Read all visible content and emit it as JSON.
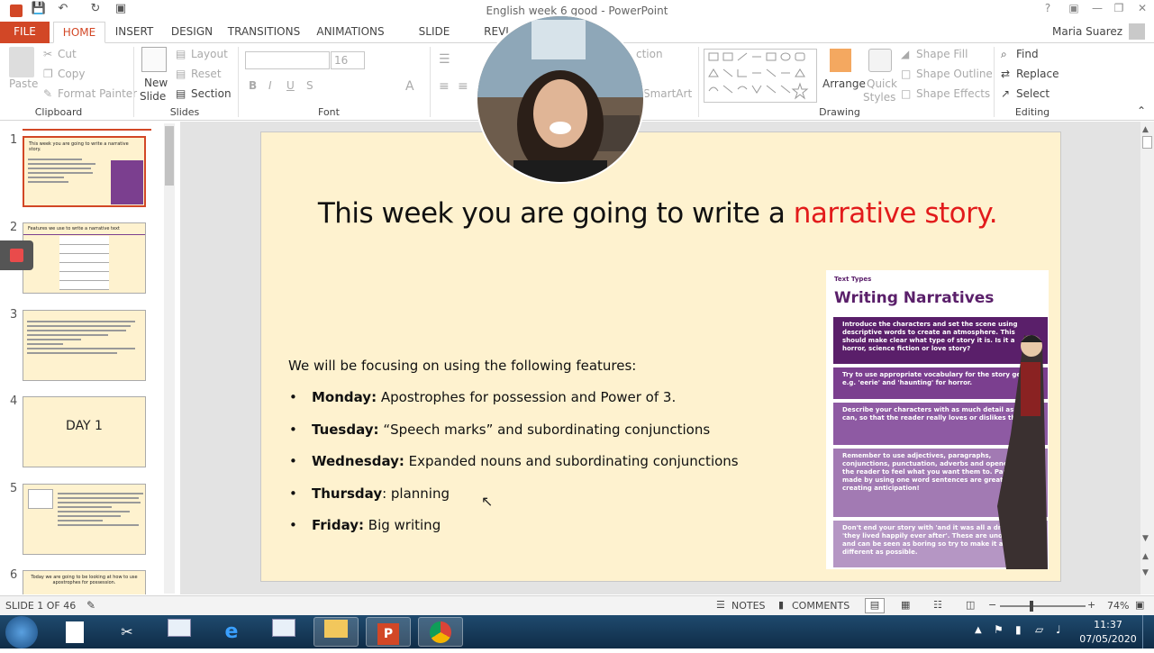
{
  "window": {
    "title": "English  week 6  good - PowerPoint",
    "user": "Maria Suarez"
  },
  "tabs": [
    {
      "label": "FILE"
    },
    {
      "label": "HOME"
    },
    {
      "label": "INSERT"
    },
    {
      "label": "DESIGN"
    },
    {
      "label": "TRANSITIONS"
    },
    {
      "label": "ANIMATIONS"
    },
    {
      "label": "SLIDE SHOW"
    },
    {
      "label": "REVI"
    }
  ],
  "ribbon": {
    "clipboard": {
      "paste": "Paste",
      "cut": "Cut",
      "copy": "Copy",
      "format_painter": "Format Painter",
      "group": "Clipboard"
    },
    "slides": {
      "new_slide_1": "New",
      "new_slide_2": "Slide",
      "layout": "Layout",
      "reset": "Reset",
      "section": "Section",
      "group": "Slides"
    },
    "font": {
      "size": "16",
      "group": "Font",
      "bold": "B",
      "italic": "I",
      "underline": "U",
      "shadow": "S"
    },
    "paragraph": {
      "direction": "ction",
      "smartart": "SmartArt"
    },
    "drawing": {
      "arrange_1": "Arrange",
      "quick_1": "Quick",
      "quick_2": "Styles",
      "shape_fill": "Shape Fill",
      "shape_outline": "Shape Outline",
      "shape_effects": "Shape Effects",
      "group": "Drawing"
    },
    "editing": {
      "find": "Find",
      "replace": "Replace",
      "select": "Select",
      "group": "Editing"
    }
  },
  "thumbnails": [
    {
      "num": "1",
      "text": "This week you are going to write a narrative story."
    },
    {
      "num": "2",
      "text": "Features we use to write a narrative text"
    },
    {
      "num": "3",
      "text": ""
    },
    {
      "num": "4",
      "text": "DAY 1"
    },
    {
      "num": "5",
      "text": ""
    },
    {
      "num": "6",
      "text": "Today we are going to be looking at how to use apostrophes for possession."
    }
  ],
  "slide": {
    "title_part1": "This week you are going to write a ",
    "title_part2": "narrative story.",
    "intro": "We will be focusing on using the following features:",
    "features": [
      {
        "day": "Monday:",
        "text": " Apostrophes for possession and Power of 3."
      },
      {
        "day": "Tuesday:",
        "text": " “Speech marks” and subordinating conjunctions"
      },
      {
        "day": "Wednesday:",
        "text": " Expanded nouns and subordinating conjunctions"
      },
      {
        "day": "Thursday",
        "text": ": planning"
      },
      {
        "day": "Friday:",
        "text": " Big writing"
      }
    ]
  },
  "poster": {
    "eyebrow": "Text Types",
    "title": "Writing Narratives",
    "tips": [
      "Introduce the characters and set the scene using descriptive words to create an atmosphere. This should make clear what type of story it is. Is it a horror, science fiction or love story?",
      "Try to use appropriate vocabulary for the story genre e.g. 'eerie' and 'haunting' for horror.",
      "Describe your characters with as much detail as you can, so that the reader really loves or dislikes them.",
      "Remember to use adjectives, paragraphs, conjunctions, punctuation, adverbs and openers to get the reader to feel what you want them to. Pauses made by using one word sentences are great at creating anticipation!",
      "Don't end your story with 'and it was all a dream' or 'they lived happily ever after'. These are unoriginal and can be seen as boring so try to make it as different as possible."
    ],
    "colors": [
      "#5a1f6a",
      "#7b3f8f",
      "#8e5aa3",
      "#a27ab3",
      "#b596c4"
    ]
  },
  "status": {
    "slide": "SLIDE 1 OF 46",
    "notes": "NOTES",
    "comments": "COMMENTS",
    "zoom": "74%"
  },
  "taskbar": {
    "time": "11:37",
    "date": "07/05/2020"
  }
}
